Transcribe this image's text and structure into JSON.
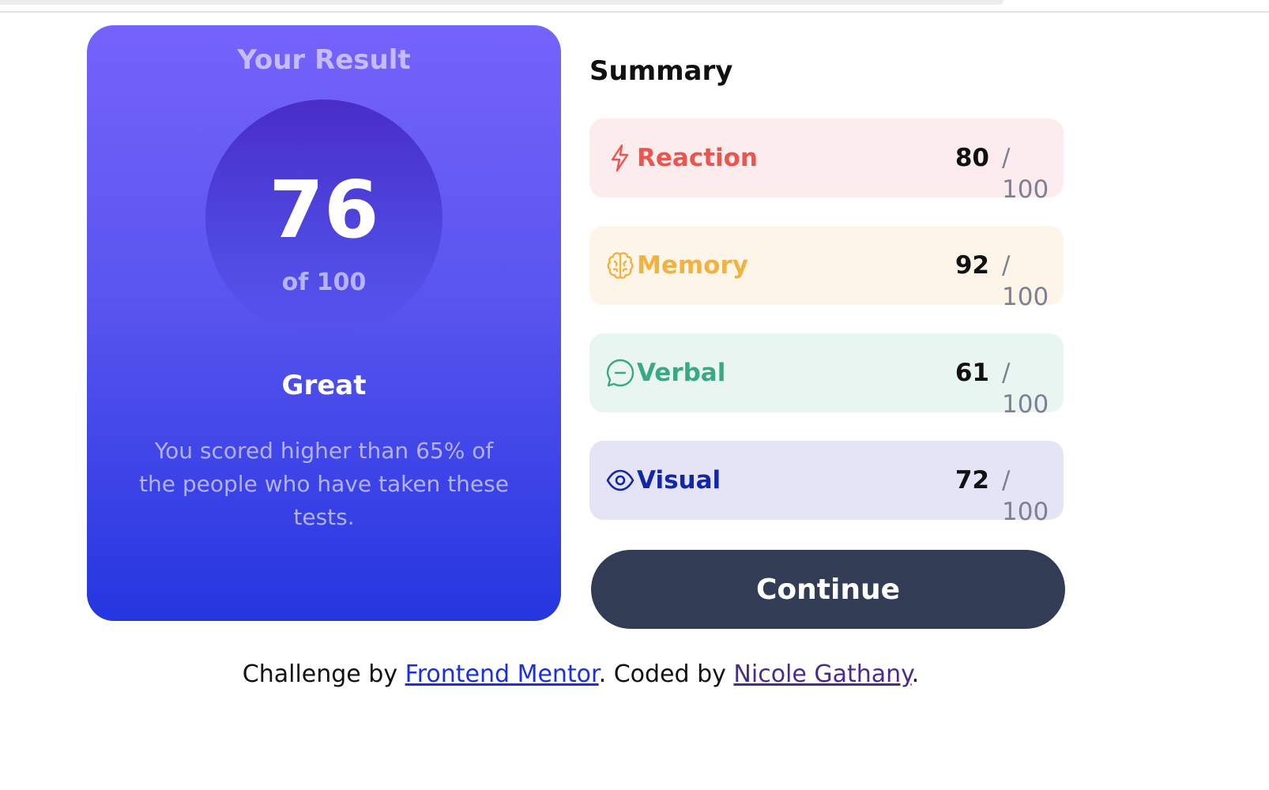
{
  "result": {
    "title": "Your Result",
    "score": "76",
    "of_label": "of 100",
    "rating": "Great",
    "description": "You scored higher than 65% of the people who have taken these tests."
  },
  "summary": {
    "title": "Summary",
    "items": [
      {
        "label": "Reaction",
        "score": "80",
        "max": "/ 100",
        "icon": "lightning-icon",
        "color": "#e8574f",
        "bg": "#fdeced"
      },
      {
        "label": "Memory",
        "score": "92",
        "max": "/ 100",
        "icon": "brain-icon",
        "color": "#f0b343",
        "bg": "#fdf5e7"
      },
      {
        "label": "Verbal",
        "score": "61",
        "max": "/ 100",
        "icon": "chat-bubble-icon",
        "color": "#3aa982",
        "bg": "#e9f5f1"
      },
      {
        "label": "Visual",
        "score": "72",
        "max": "/ 100",
        "icon": "eye-icon",
        "color": "#1226a8",
        "bg": "#e5e4f7"
      }
    ]
  },
  "continue_label": "Continue",
  "footer": {
    "prefix": "Challenge by ",
    "link1": "Frontend Mentor",
    "middle": ". Coded by ",
    "link2": "Nicole Gathany",
    "suffix": "."
  }
}
